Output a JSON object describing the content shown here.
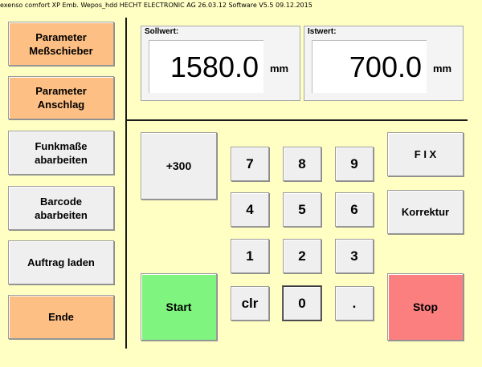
{
  "window": {
    "title": "exenso comfort  XP Emb. Wepos_hdd  HECHT ELECTRONIC AG 26.03.12    Software V5.5  09.12.2015"
  },
  "sidebar": {
    "parameter_messschieber": "Parameter\nMeßschieber",
    "parameter_anschlag": "Parameter\nAnschlag",
    "funkmasse": "Funkmaße\nabarbeiten",
    "barcode": "Barcode\nabarbeiten",
    "auftrag": "Auftrag laden",
    "ende": "Ende"
  },
  "sollwert": {
    "label": "Sollwert:",
    "value": "1580.0",
    "unit": "mm"
  },
  "istwert": {
    "label": "Istwert:",
    "value": "700.0",
    "unit": "mm"
  },
  "actions": {
    "plus300": "+300",
    "fix": "F I X",
    "korrektur": "Korrektur",
    "start": "Start",
    "stop": "Stop"
  },
  "keypad": {
    "k7": "7",
    "k8": "8",
    "k9": "9",
    "k4": "4",
    "k5": "5",
    "k6": "6",
    "k1": "1",
    "k2": "2",
    "k3": "3",
    "clr": "clr",
    "k0": "0",
    "dot": "."
  },
  "colors": {
    "background": "#ffffc4",
    "orange_button": "#fdbf83",
    "start_button": "#7ff47f",
    "stop_button": "#fc7f7f"
  }
}
